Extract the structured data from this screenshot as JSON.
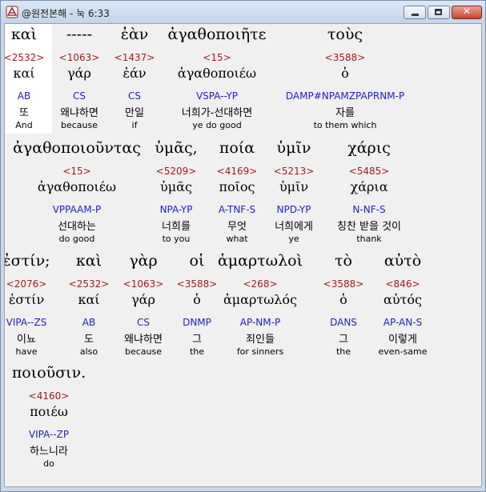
{
  "window": {
    "title": "@원전본해 - 눅 6:33",
    "app_icon": "bible-app-icon",
    "controls": {
      "minimize": "minimize-icon",
      "maximize": "maximize-icon",
      "close": "✕"
    }
  },
  "rows": [
    [
      {
        "greek": "καὶ",
        "strong": "<2532>",
        "lexeme": "καί",
        "parsing": "AB",
        "korean": "또",
        "english": "And"
      },
      {
        "greek": "-----",
        "strong": "<1063>",
        "lexeme": "γάρ",
        "parsing": "CS",
        "korean": "왜냐하면",
        "english": "because"
      },
      {
        "greek": "ἐὰν",
        "strong": "<1437>",
        "lexeme": "ἐάν",
        "parsing": "CS",
        "korean": "만일",
        "english": "if"
      },
      {
        "greek": "ἀγαθοποιῆτε",
        "strong": "<15>",
        "lexeme": "ἀγαθοποιέω",
        "parsing": "VSPA--YP",
        "korean": "너희가-선대하면",
        "english": "ye do good"
      },
      {
        "greek": "τοὺς",
        "strong": "<3588>",
        "lexeme": "ὁ",
        "parsing": "DAMP#NPAMZPAPRNM-P",
        "korean": "자를",
        "english": "to them which"
      }
    ],
    [
      {
        "greek": "ἀγαθοποιοῦντας",
        "strong": "<15>",
        "lexeme": "ἀγαθοποιέω",
        "parsing": "VPPAAM-P",
        "korean": "선대하는",
        "english": "do good"
      },
      {
        "greek": "ὑμᾶς,",
        "strong": "<5209>",
        "lexeme": "ὑμᾶς",
        "parsing": "NPA-YP",
        "korean": "너희를",
        "english": "to you"
      },
      {
        "greek": "ποία",
        "strong": "<4169>",
        "lexeme": "ποῖος",
        "parsing": "A-TNF-S",
        "korean": "무엇",
        "english": "what"
      },
      {
        "greek": "ὑμῖν",
        "strong": "<5213>",
        "lexeme": "ὑμῖν",
        "parsing": "NPD-YP",
        "korean": "너희에게",
        "english": "ye"
      },
      {
        "greek": "χάρις",
        "strong": "<5485>",
        "lexeme": "χάρια",
        "parsing": "N-NF-S",
        "korean": "칭찬 받을 것이",
        "english": "thank"
      }
    ],
    [
      {
        "greek": "ἐστίν;",
        "strong": "<2076>",
        "lexeme": "ἐστίν",
        "parsing": "VIPA--ZS",
        "korean": "이뇨",
        "english": "have"
      },
      {
        "greek": "καὶ",
        "strong": "<2532>",
        "lexeme": "καί",
        "parsing": "AB",
        "korean": "도",
        "english": "also"
      },
      {
        "greek": "γὰρ",
        "strong": "<1063>",
        "lexeme": "γάρ",
        "parsing": "CS",
        "korean": "왜냐하면",
        "english": "because"
      },
      {
        "greek": "οἱ",
        "strong": "<3588>",
        "lexeme": "ὁ",
        "parsing": "DNMP",
        "korean": "그",
        "english": "the"
      },
      {
        "greek": "ἁμαρτωλοὶ",
        "strong": "<268>",
        "lexeme": "ἁμαρτωλός",
        "parsing": "AP-NM-P",
        "korean": "죄인들",
        "english": "for sinners"
      },
      {
        "greek": "τὸ",
        "strong": "<3588>",
        "lexeme": "ὁ",
        "parsing": "DANS",
        "korean": "그",
        "english": "the"
      },
      {
        "greek": "αὐτὸ",
        "strong": "<846>",
        "lexeme": "αὐτός",
        "parsing": "AP-AN-S",
        "korean": "이렇게",
        "english": "even-same"
      }
    ],
    [
      {
        "greek": "ποιοῦσιν.",
        "strong": "<4160>",
        "lexeme": "ποιέω",
        "parsing": "VIPA--ZP",
        "korean": "하느니라",
        "english": "do"
      }
    ]
  ]
}
